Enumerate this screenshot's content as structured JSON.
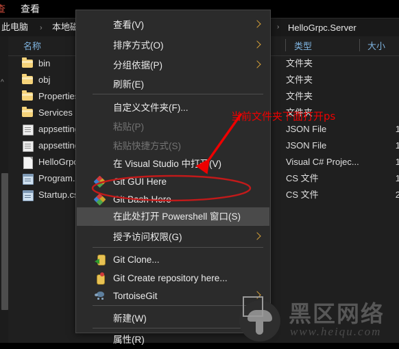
{
  "window": {
    "ribbon_tabs": [
      {
        "label": "查",
        "id": "clipped"
      },
      {
        "label": "查看",
        "id": "view"
      }
    ],
    "breadcrumb": {
      "item0": "此电脑",
      "separator": "›",
      "item1": "本地磁盘"
    },
    "tree_item": {
      "chevron": "›",
      "label": "HelloGrpc.Server"
    }
  },
  "columns": {
    "name": "名称",
    "type": "类型",
    "size": "大小"
  },
  "files": [
    {
      "name": "bin",
      "icon": "folder-icon",
      "type": "文件夹",
      "size": ""
    },
    {
      "name": "obj",
      "icon": "folder-icon",
      "type": "文件夹",
      "size": ""
    },
    {
      "name": "Properties",
      "icon": "folder-icon",
      "type": "文件夹",
      "size": ""
    },
    {
      "name": "Services",
      "icon": "folder-icon",
      "type": "文件夹",
      "size": ""
    },
    {
      "name": "appsetting",
      "icon": "config-icon",
      "type": "JSON File",
      "size": "1"
    },
    {
      "name": "appsetting",
      "icon": "config-icon",
      "type": "JSON File",
      "size": "1"
    },
    {
      "name": "HelloGrpc",
      "icon": "document-icon",
      "type": "Visual C# Projec...",
      "size": "1"
    },
    {
      "name": "Program.c",
      "icon": "cs-file-icon",
      "type": "CS 文件",
      "size": "1"
    },
    {
      "name": "Startup.cs",
      "icon": "cs-file-icon",
      "type": "CS 文件",
      "size": "2"
    }
  ],
  "context_menu": {
    "items": [
      {
        "label": "查看(V)",
        "accel": "V",
        "submenu": true,
        "disabled": false,
        "icon": null,
        "highlighted": false
      },
      {
        "label": "排序方式(O)",
        "accel": "O",
        "submenu": true,
        "disabled": false,
        "icon": null,
        "highlighted": false
      },
      {
        "label": "分组依据(P)",
        "accel": "P",
        "submenu": true,
        "disabled": false,
        "icon": null,
        "highlighted": false
      },
      {
        "label": "刷新(E)",
        "accel": "E",
        "submenu": false,
        "disabled": false,
        "icon": null,
        "highlighted": false
      },
      {
        "label": "自定义文件夹(F)...",
        "accel": "F",
        "submenu": false,
        "disabled": false,
        "icon": null,
        "highlighted": false
      },
      {
        "label": "粘贴(P)",
        "accel": "P",
        "submenu": false,
        "disabled": true,
        "icon": null,
        "highlighted": false
      },
      {
        "label": "粘贴快捷方式(S)",
        "accel": "S",
        "submenu": false,
        "disabled": true,
        "icon": null,
        "highlighted": false
      },
      {
        "label": "在 Visual Studio 中打开(V)",
        "accel": "V",
        "submenu": false,
        "disabled": false,
        "icon": null,
        "highlighted": false
      },
      {
        "label": "Git GUI Here",
        "accel": "G",
        "submenu": false,
        "disabled": false,
        "icon": "git-icon",
        "highlighted": false
      },
      {
        "label": "Git Bash Here",
        "accel": "a",
        "submenu": false,
        "disabled": false,
        "icon": "git-icon",
        "highlighted": false
      },
      {
        "label": "在此处打开 Powershell 窗口(S)",
        "accel": "S",
        "submenu": false,
        "disabled": false,
        "icon": null,
        "highlighted": true
      },
      {
        "label": "授予访问权限(G)",
        "accel": "G",
        "submenu": true,
        "disabled": false,
        "icon": null,
        "highlighted": false
      },
      {
        "label": "Git Clone...",
        "accel": "",
        "submenu": false,
        "disabled": false,
        "icon": "git-clone-icon",
        "highlighted": false
      },
      {
        "label": "Git Create repository here...",
        "accel": "",
        "submenu": false,
        "disabled": false,
        "icon": "git-create-icon",
        "highlighted": false
      },
      {
        "label": "TortoiseGit",
        "accel": "T",
        "submenu": true,
        "disabled": false,
        "icon": "tortoise-icon",
        "highlighted": false
      },
      {
        "label": "新建(W)",
        "accel": "W",
        "submenu": true,
        "disabled": false,
        "icon": null,
        "highlighted": false
      },
      {
        "label": "属性(R)",
        "accel": "R",
        "submenu": false,
        "disabled": false,
        "icon": null,
        "highlighted": false
      }
    ]
  },
  "annotations": {
    "note_text": "当前文件夹下面打开ps",
    "color": "#ee0000"
  },
  "watermark": {
    "brand": "黑区网络",
    "url": "www.heiqu.com"
  },
  "colors": {
    "menu_bg": "#2b2b2b",
    "highlight": "#4a4a4a",
    "pane_bg": "#1f1f1f",
    "column_header_text": "#7fb4e0",
    "folder": "#f5d37a",
    "submenu_arrow": "#d8a23a"
  }
}
